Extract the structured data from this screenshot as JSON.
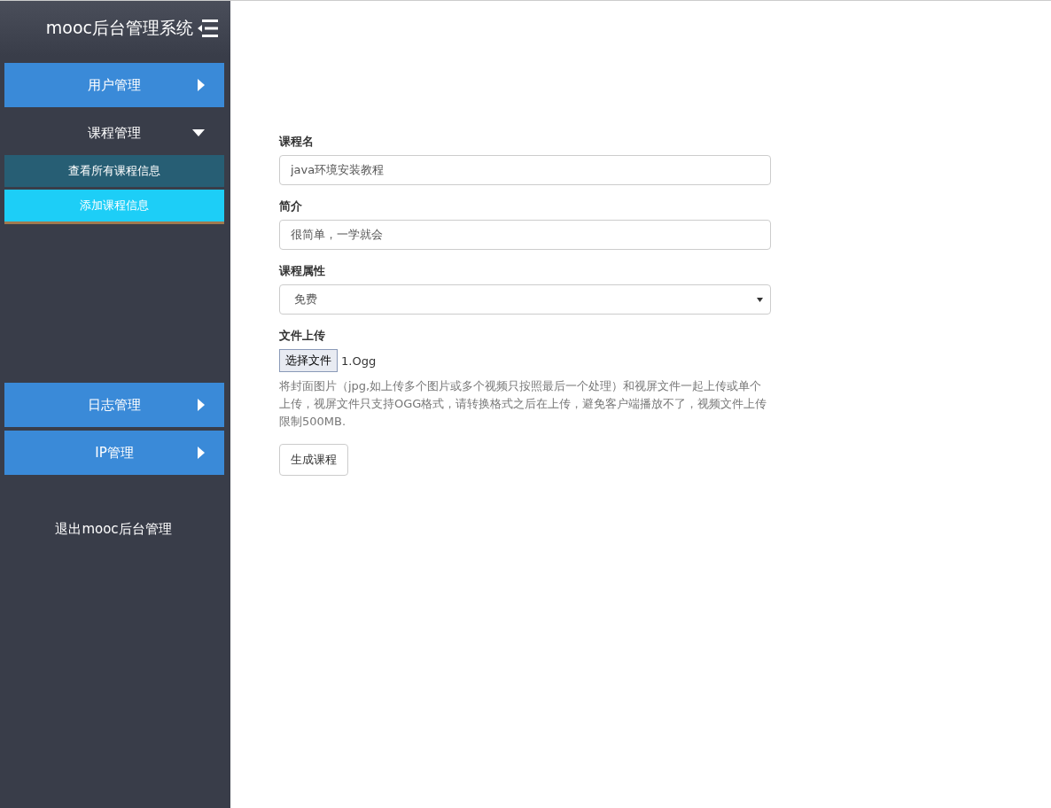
{
  "sidebar": {
    "title": "mooc后台管理系统",
    "menu": [
      {
        "label": "用户管理",
        "expanded": false
      },
      {
        "label": "课程管理",
        "expanded": true,
        "children": [
          {
            "label": "查看所有课程信息",
            "selected": false
          },
          {
            "label": "添加课程信息",
            "selected": true
          }
        ]
      },
      {
        "label": "日志管理",
        "expanded": false
      },
      {
        "label": "IP管理",
        "expanded": false
      }
    ],
    "logout": "退出mooc后台管理"
  },
  "form": {
    "fields": [
      {
        "kind": "text",
        "label": "课程名",
        "value": "java环境安装教程"
      },
      {
        "kind": "text",
        "label": "简介",
        "value": "很简单，一学就会"
      },
      {
        "kind": "select",
        "label": "课程属性",
        "value": "免费"
      },
      {
        "kind": "file",
        "label": "文件上传",
        "button": "选择文件",
        "value": "1.Ogg",
        "help": "将封面图片（jpg,如上传多个图片或多个视频只按照最后一个处理）和视屏文件一起上传或单个上传，视屏文件只支持OGG格式，请转换格式之后在上传，避免客户端播放不了，视频文件上传限制500MB."
      }
    ],
    "submit": "生成课程"
  }
}
